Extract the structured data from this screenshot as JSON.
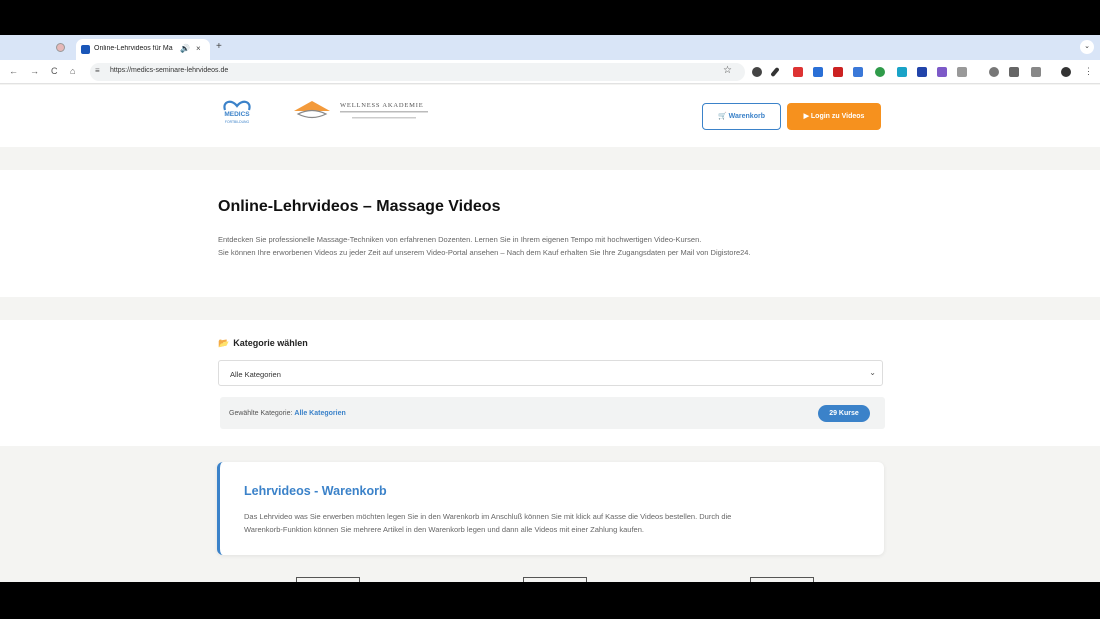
{
  "browser": {
    "tab_title": "Online-Lehrvideos für Ma",
    "url": "https://medics-seminare-lehrvideos.de",
    "newtab_glyph": "+",
    "close_glyph": "×",
    "audio_glyph": "🔊",
    "dropdown_glyph": "⌄",
    "back_glyph": "←",
    "forward_glyph": "→",
    "reload_glyph": "C",
    "home_glyph": "⌂",
    "tune_glyph": "≡",
    "star_glyph": "☆",
    "menu_glyph": "⋮"
  },
  "header": {
    "logo_medics_text": "MEDICS",
    "logo_medics_sub": "FORTBILDUNG",
    "logo_wellness_text": "WELLNESS AKADEMIE",
    "cart_label": "Warenkorb",
    "login_label": "Login zu Videos"
  },
  "hero": {
    "title": "Online-Lehrvideos – Massage Videos",
    "intro_line1": "Entdecken Sie professionelle Massage-Techniken von erfahrenen Dozenten. Lernen Sie in Ihrem eigenen Tempo mit hochwertigen Video-Kursen.",
    "intro_line2": "Sie können Ihre erworbenen Videos zu jeder Zeit auf unserem Video-Portal ansehen – Nach dem Kauf erhalten Sie Ihre Zugangsdaten per Mail von Digistore24."
  },
  "category": {
    "label": "Kategorie wählen",
    "folder_glyph": "📂",
    "selected_option": "Alle Kategorien",
    "chevron_glyph": "⌄",
    "selected_prefix": "Gewählte Kategorie:",
    "selected_value": "Alle Kategorien",
    "count_badge": "29 Kurse"
  },
  "info": {
    "title": "Lehrvideos - Warenkorb",
    "line1": "Das Lehrvideo was Sie erwerben möchten legen Sie in den Warenkorb im Anschluß können Sie mit klick auf Kasse die Videos bestellen. Durch die",
    "line2": "Warenkorb-Funktion können Sie mehrere Artikel in den Warenkorb legen und dann alle Videos mit einer Zahlung kaufen."
  },
  "colors": {
    "accent_blue": "#3b82c9",
    "accent_orange": "#f6911e"
  }
}
